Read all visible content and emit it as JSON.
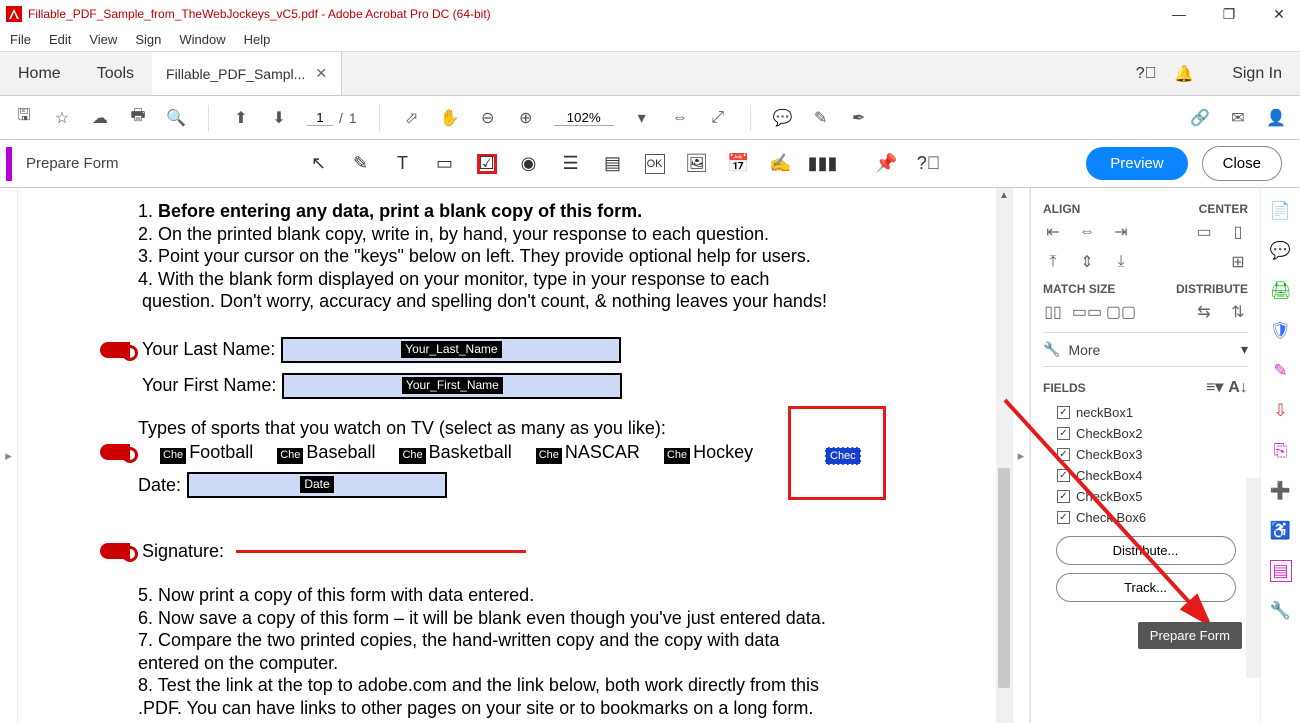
{
  "window": {
    "title": "Fillable_PDF_Sample_from_TheWebJockeys_vC5.pdf - Adobe Acrobat Pro DC (64-bit)"
  },
  "menu": {
    "file": "File",
    "edit": "Edit",
    "view": "View",
    "sign": "Sign",
    "window": "Window",
    "help": "Help"
  },
  "tabs": {
    "home": "Home",
    "tools": "Tools",
    "doc": "Fillable_PDF_Sampl...",
    "signin": "Sign In"
  },
  "page": {
    "current": "1",
    "sep": "/",
    "total": "1",
    "zoom": "102%"
  },
  "formbar": {
    "label": "Prepare Form",
    "preview": "Preview",
    "close": "Close"
  },
  "doc": {
    "l1a": "1. ",
    "l1b": "Before entering any data, print a blank copy of this form.",
    "l2": "2. On the printed blank copy, write in, by hand, your response to each question.",
    "l3": "3. Point your cursor on the \"keys\" below on left. They provide optional help for users.",
    "l4a": "4. With the blank form displayed on your monitor, type in your response to each",
    "l4b": "question. Don't worry, accuracy and spelling don't count, & nothing leaves your hands!",
    "lastname_label": "Your Last Name:",
    "lastname_field": "Your_Last_Name",
    "firstname_label": "Your First Name:",
    "firstname_field": "Your_First_Name",
    "sports_label": "Types of sports that you watch on TV (select as many as you like):",
    "chk_prefix": "Che",
    "sport1": "Football",
    "sport2": "Baseball",
    "sport3": "Basketball",
    "sport4": "NASCAR",
    "sport5": "Hockey",
    "sel_chk": "Chec",
    "date_label": "Date:",
    "date_field": "Date",
    "sig_label": "Signature:",
    "l5": "5. Now print a copy of this form with data entered.",
    "l6": "6. Now save a copy of this form – it will be blank even though you've just entered data.",
    "l7a": "7. Compare the two printed copies, the hand-written copy and the copy with data",
    "l7b": "entered on the computer.",
    "l8a": "8. Test the link at the top to adobe.com and the link below, both work directly from this",
    "l8b": ".PDF. You can have links to other pages on your site or to bookmarks on a long form."
  },
  "panel": {
    "align": "ALIGN",
    "center": "CENTER",
    "match": "MATCH SIZE",
    "dist": "DISTRIBUTE",
    "more": "More",
    "fields": "FIELDS",
    "items": [
      "neckBox1",
      "CheckBox2",
      "CheckBox3",
      "CheckBox4",
      "CheckBox5",
      "Check Box6"
    ],
    "distribute": "Distribute...",
    "track": "Track..."
  },
  "tooltip": "Prepare Form"
}
